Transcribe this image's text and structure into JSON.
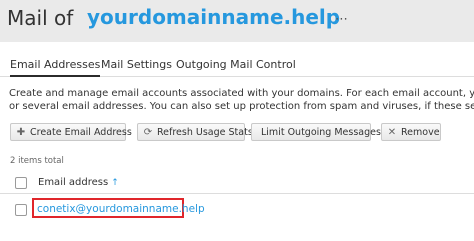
{
  "header": {
    "title_prefix": "Mail of",
    "domain": "yourdomainname.help",
    "more_icon": "more-dots-icon"
  },
  "tabs": [
    {
      "label": "Email Addresses",
      "active": true
    },
    {
      "label": "Mail Settings",
      "active": false
    },
    {
      "label": "Outgoing Mail Control",
      "active": false
    }
  ],
  "description": {
    "line1": "Create and manage email accounts associated with your domains. For each email account, you can set up",
    "line2": "or several email addresses. You can also set up protection from spam and viruses, if these services are a"
  },
  "toolbar": {
    "create": {
      "label": "Create Email Address",
      "icon": "plus-icon"
    },
    "refresh": {
      "label": "Refresh Usage Stats",
      "icon": "refresh-icon"
    },
    "limit": {
      "label": "Limit Outgoing Messages",
      "icon": ""
    },
    "remove": {
      "label": "Remove",
      "icon": "close-icon"
    }
  },
  "list": {
    "total_label": "2 items total",
    "column_header": "Email address",
    "sort_icon": "sort-up-arrow-icon",
    "rows": [
      {
        "email": "conetix@yourdomainname.help",
        "highlighted": true
      }
    ]
  },
  "colors": {
    "accent": "#2698de",
    "highlight_border": "#e0262b",
    "header_bg": "#eaeaea"
  }
}
